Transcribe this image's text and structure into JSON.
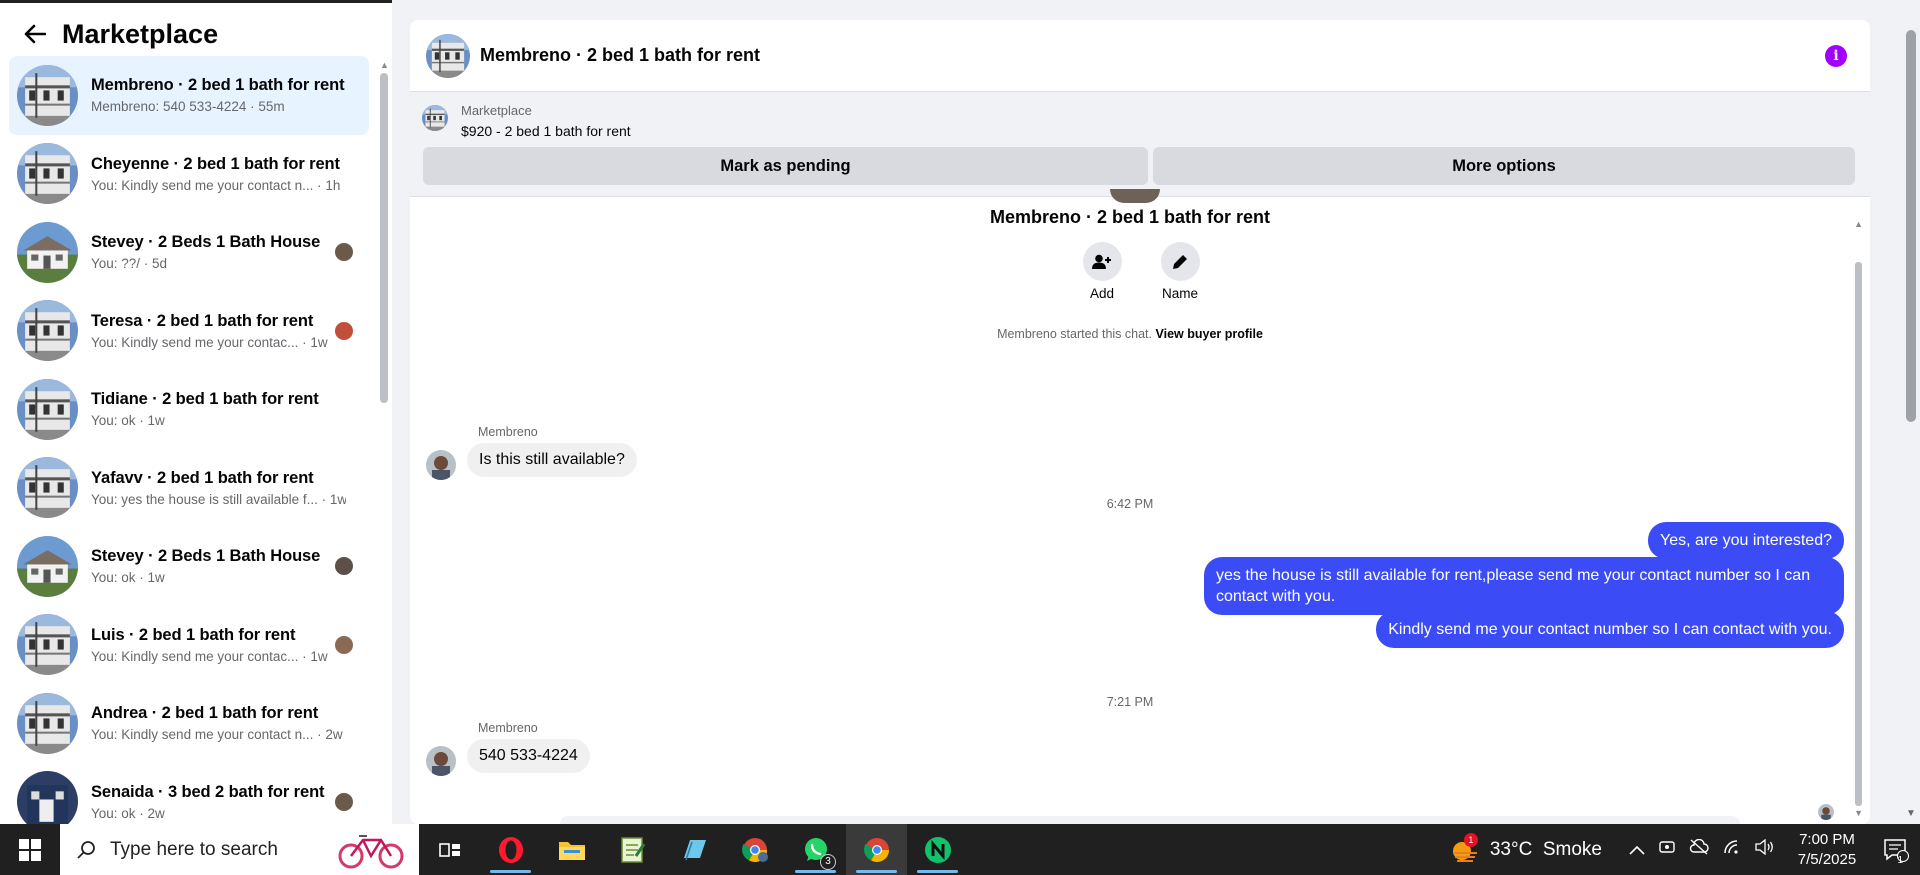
{
  "sidebar": {
    "title": "Marketplace",
    "conversations": [
      {
        "title": "Membreno · 2 bed 1 bath for rent",
        "sub": "Membreno: 540 533-4224 · 55m",
        "active": true
      },
      {
        "title": "Cheyenne · 2 bed 1 bath for rent",
        "sub": "You: Kindly send me your contact n... · 1h"
      },
      {
        "title": "Stevey · 2 Beds 1 Bath House",
        "sub": "You: ??/ · 5d"
      },
      {
        "title": "Teresa · 2 bed 1 bath for rent",
        "sub": "You: Kindly send me your contac... · 1w"
      },
      {
        "title": "Tidiane · 2 bed 1 bath for rent",
        "sub": "You: ok · 1w"
      },
      {
        "title": "Yafavv · 2 bed 1 bath for rent",
        "sub": "You: yes the house is still available f... · 1w"
      },
      {
        "title": "Stevey · 2 Beds 1 Bath House",
        "sub": "You: ok · 1w"
      },
      {
        "title": "Luis · 2 bed 1 bath for rent",
        "sub": "You: Kindly send me your contac... · 1w"
      },
      {
        "title": "Andrea · 2 bed 1 bath for rent",
        "sub": "You: Kindly send me your contact n... · 2w"
      },
      {
        "title": "Senaida · 3 bed 2 bath for rent",
        "sub": "You: ok · 2w"
      }
    ]
  },
  "chat": {
    "title": "Membreno · 2 bed 1 bath for rent",
    "listing": {
      "label": "Marketplace",
      "price_title": "$920 - 2 bed 1 bath for rent",
      "pending_button": "Mark as pending",
      "more_button": "More options"
    },
    "intro_title": "Membreno · 2 bed 1 bath for rent",
    "actions": {
      "add": "Add",
      "name": "Name"
    },
    "started_text": "Membreno started this chat.",
    "view_profile": "View buyer profile",
    "messages": {
      "sender1": "Membreno",
      "in1": "Is this still available?",
      "time1": "6:42 PM",
      "out1": "Yes, are you interested?",
      "out2": "yes the house is still available for rent,please send me your contact number so I can contact with you.",
      "out3": "Kindly send me your contact number so I can contact with you.",
      "time2": "7:21 PM",
      "sender2": "Membreno",
      "in2": "540 533-4224"
    }
  },
  "taskbar": {
    "search_placeholder": "Type here to search",
    "whatsapp_badge": "3",
    "weather_badge": "1",
    "weather": "33°C  Smoke",
    "time": "7:00 PM",
    "date": "7/5/2025",
    "notification_count": "1"
  },
  "colors": {
    "accent_out": "#3b4cf7",
    "active_row": "#e7f3ff",
    "info": "#a100ff"
  }
}
